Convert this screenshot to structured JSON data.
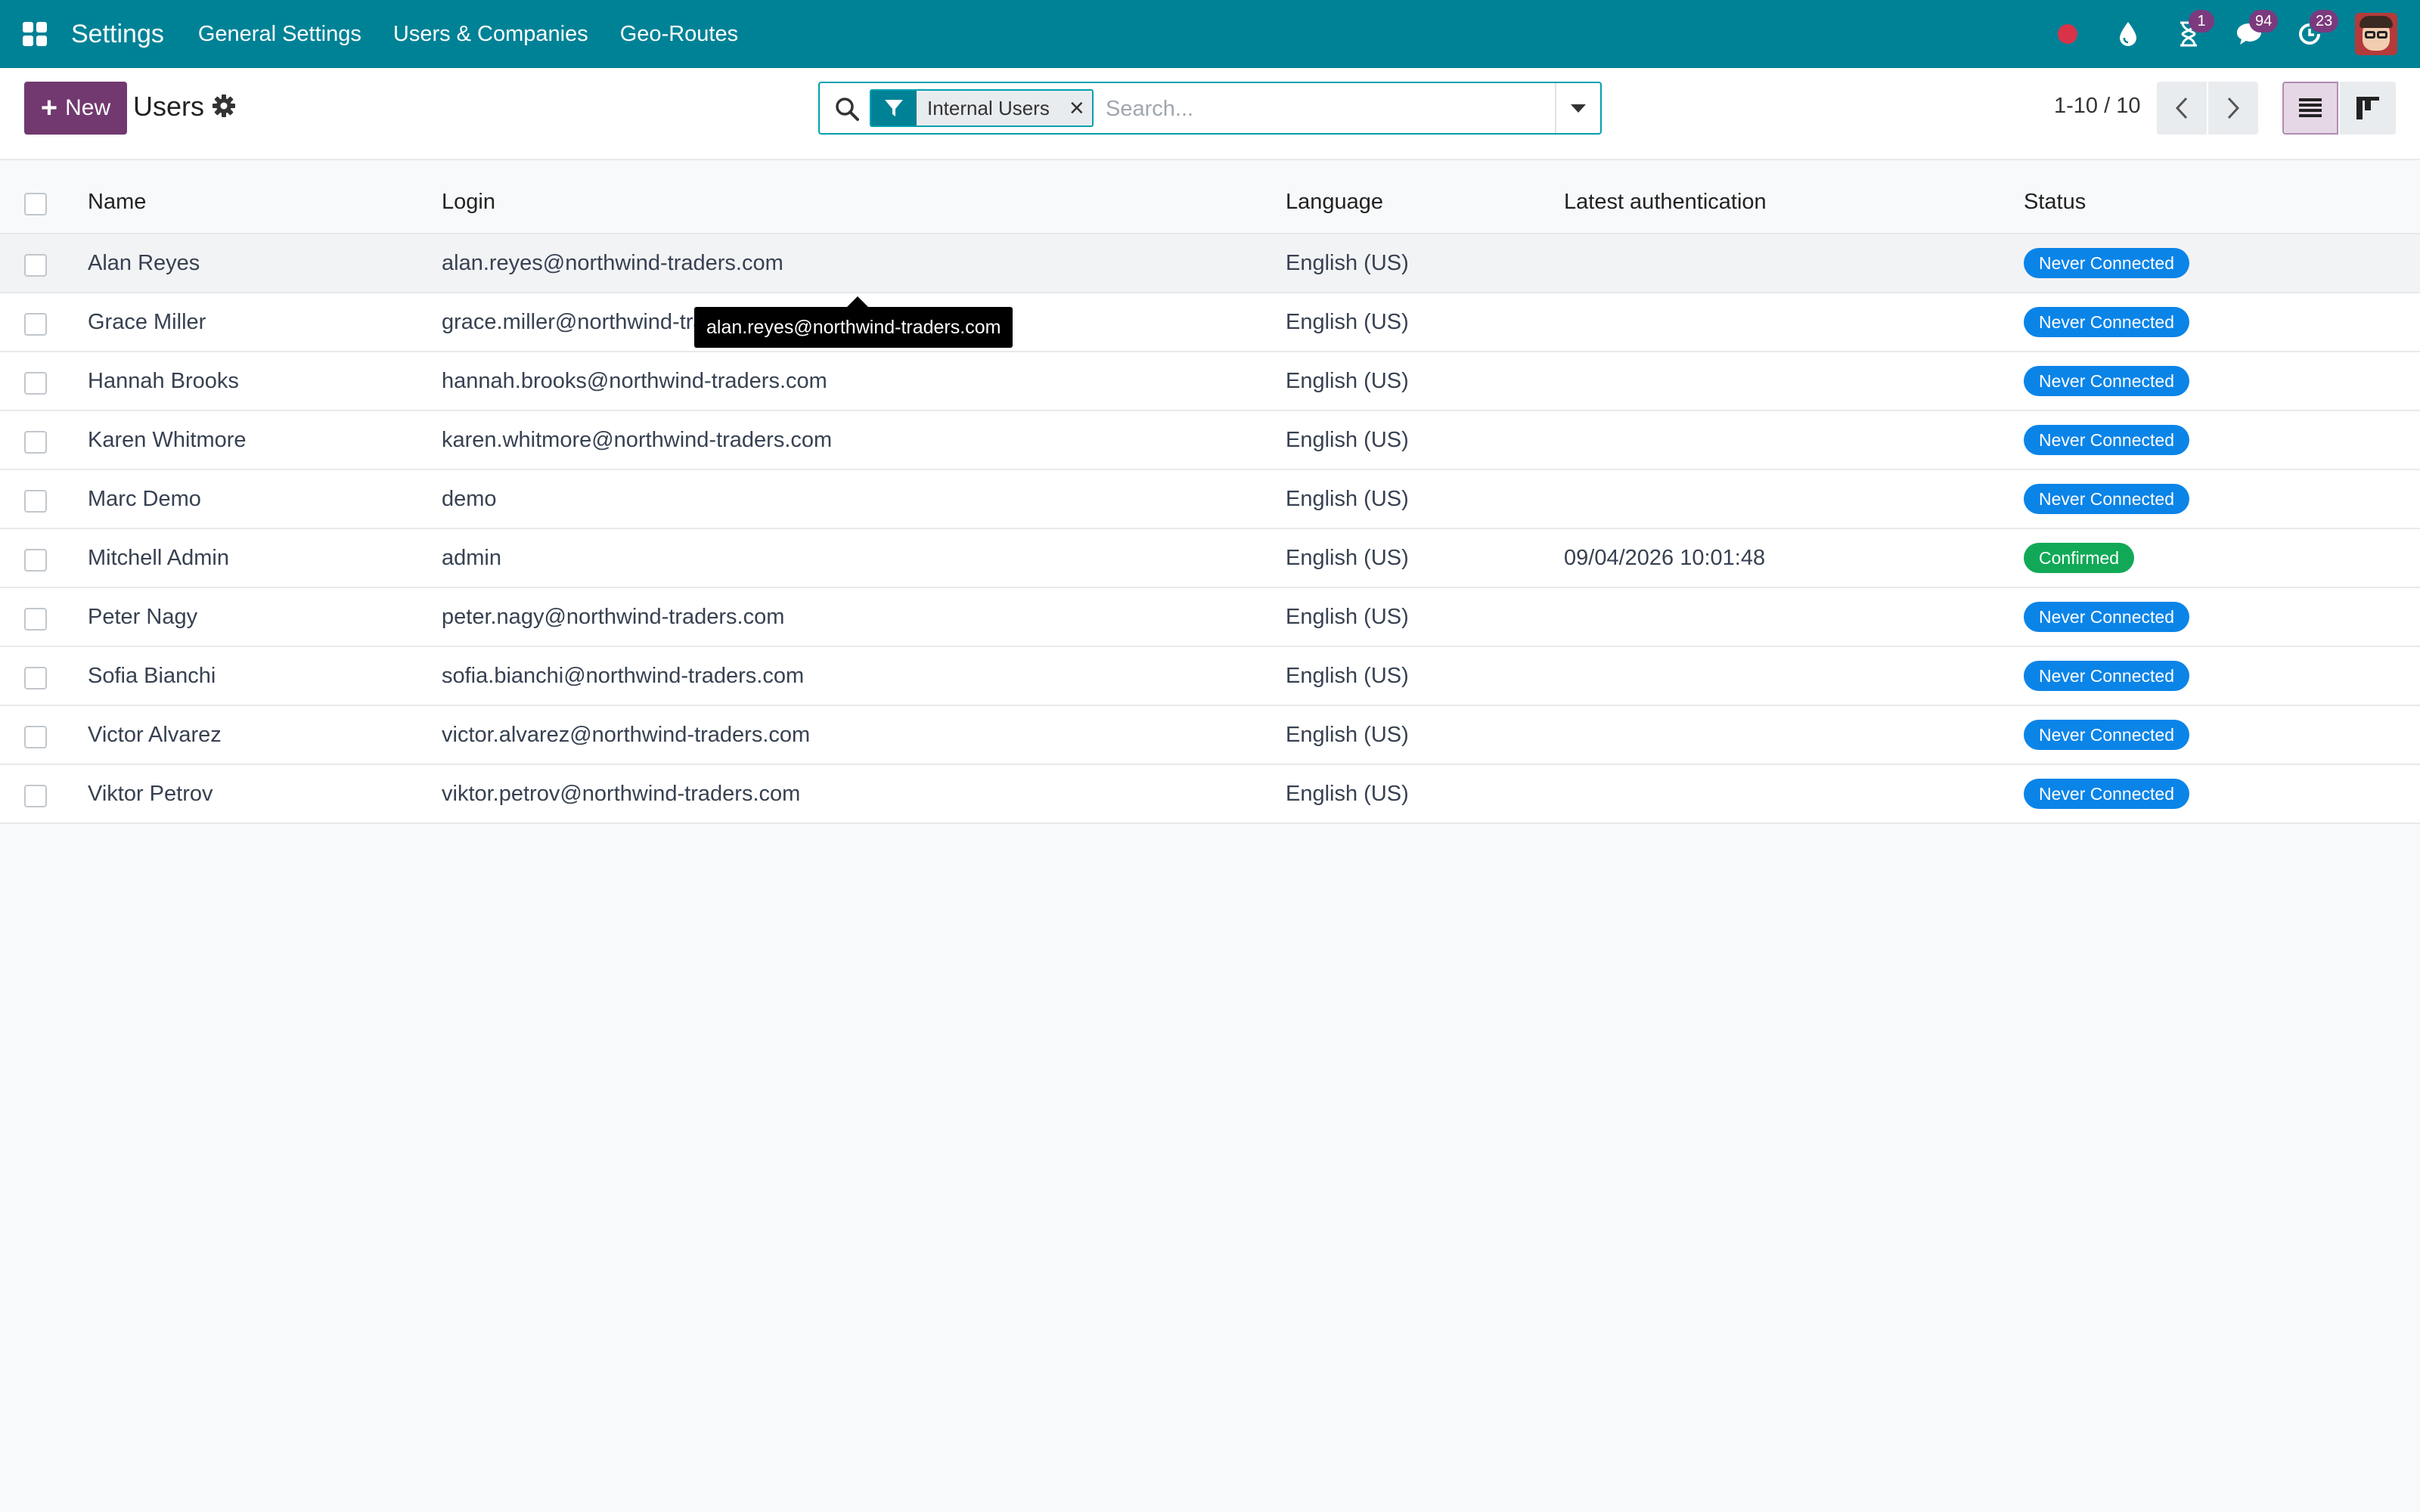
{
  "navbar": {
    "app_name": "Settings",
    "menus": [
      "General Settings",
      "Users & Companies",
      "Geo-Routes"
    ],
    "badges": {
      "activities": "1",
      "messages": "94",
      "updates": "23"
    },
    "bg_color": "#008296"
  },
  "control": {
    "new_label": "New",
    "title": "Users",
    "facet_label": "Internal Users",
    "search_placeholder": "Search...",
    "pager": "1-10 / 10"
  },
  "table": {
    "columns": {
      "name": "Name",
      "login": "Login",
      "language": "Language",
      "auth": "Latest authentication",
      "status": "Status"
    },
    "rows": [
      {
        "name": "Alan Reyes",
        "login": "alan.reyes@northwind-traders.com",
        "language": "English (US)",
        "auth": "",
        "status": "Never Connected"
      },
      {
        "name": "Grace Miller",
        "login": "grace.miller@northwind-traders.com",
        "language": "English (US)",
        "auth": "",
        "status": "Never Connected"
      },
      {
        "name": "Hannah Brooks",
        "login": "hannah.brooks@northwind-traders.com",
        "language": "English (US)",
        "auth": "",
        "status": "Never Connected"
      },
      {
        "name": "Karen Whitmore",
        "login": "karen.whitmore@northwind-traders.com",
        "language": "English (US)",
        "auth": "",
        "status": "Never Connected"
      },
      {
        "name": "Marc Demo",
        "login": "demo",
        "language": "English (US)",
        "auth": "",
        "status": "Never Connected"
      },
      {
        "name": "Mitchell Admin",
        "login": "admin",
        "language": "English (US)",
        "auth": "09/04/2026 10:01:48",
        "status": "Confirmed"
      },
      {
        "name": "Peter Nagy",
        "login": "peter.nagy@northwind-traders.com",
        "language": "English (US)",
        "auth": "",
        "status": "Never Connected"
      },
      {
        "name": "Sofia Bianchi",
        "login": "sofia.bianchi@northwind-traders.com",
        "language": "English (US)",
        "auth": "",
        "status": "Never Connected"
      },
      {
        "name": "Victor Alvarez",
        "login": "victor.alvarez@northwind-traders.com",
        "language": "English (US)",
        "auth": "",
        "status": "Never Connected"
      },
      {
        "name": "Viktor Petrov",
        "login": "viktor.petrov@northwind-traders.com",
        "language": "English (US)",
        "auth": "",
        "status": "Never Connected"
      }
    ]
  },
  "status_colors": {
    "Never Connected": "#0b84e8",
    "Confirmed": "#11a957"
  },
  "tooltip": {
    "text": "alan.reyes@northwind-traders.com"
  }
}
